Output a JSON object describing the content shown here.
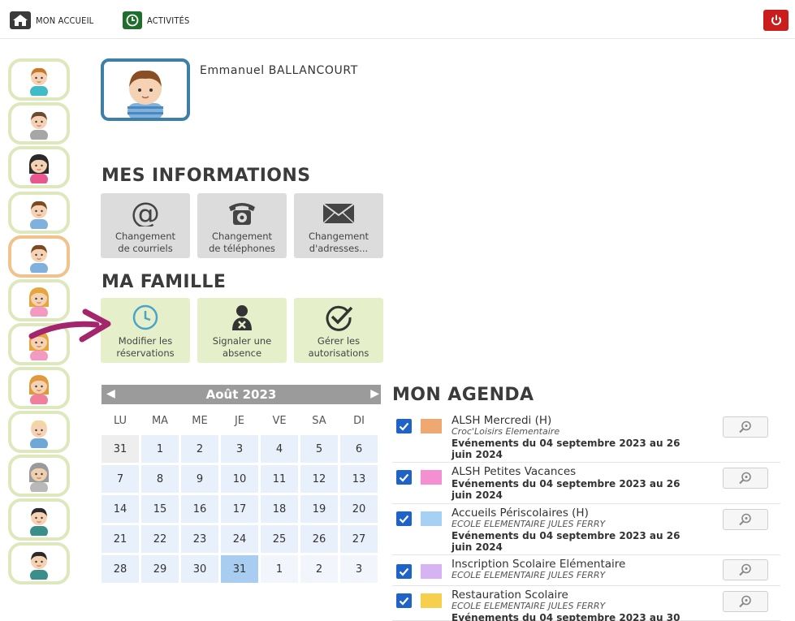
{
  "topbar": {
    "home_label": "MON ACCUEIL",
    "activities_label": "ACTIVITÉS"
  },
  "profile": {
    "name": "Emmanuel BALLANCOURT"
  },
  "mes_informations": {
    "title": "MES INFORMATIONS",
    "tiles": [
      {
        "line1": "Changement",
        "line2": "de courriels",
        "icon": "at-icon"
      },
      {
        "line1": "Changement",
        "line2": "de téléphones",
        "icon": "phone-icon"
      },
      {
        "line1": "Changement",
        "line2": "d'adresses...",
        "icon": "envelope-icon"
      }
    ]
  },
  "ma_famille": {
    "title": "MA FAMILLE",
    "tiles": [
      {
        "line1": "Modifier les",
        "line2": "réservations",
        "icon": "clock-icon"
      },
      {
        "line1": "Signaler une",
        "line2": "absence",
        "icon": "absence-icon"
      },
      {
        "line1": "Gérer les",
        "line2": "autorisations",
        "icon": "check-circle-icon"
      }
    ]
  },
  "calendar": {
    "month": "Août 2023",
    "prev": "◀",
    "next": "▶",
    "weekdays": [
      "LU",
      "MA",
      "ME",
      "JE",
      "VE",
      "SA",
      "DI"
    ],
    "weeks": [
      [
        "31",
        "1",
        "2",
        "3",
        "4",
        "5",
        "6"
      ],
      [
        "7",
        "8",
        "9",
        "10",
        "11",
        "12",
        "13"
      ],
      [
        "14",
        "15",
        "16",
        "17",
        "18",
        "19",
        "20"
      ],
      [
        "21",
        "22",
        "23",
        "24",
        "25",
        "26",
        "27"
      ],
      [
        "28",
        "29",
        "30",
        "31",
        "1",
        "2",
        "3"
      ]
    ]
  },
  "agenda": {
    "title": "MON AGENDA",
    "items": [
      {
        "title": "ALSH Mercredi (H)",
        "subtitle": "Croc'Loisirs Elementaire",
        "dates1": "Evénements du 04 septembre 2023 au 26",
        "dates2": "juin 2024",
        "color": "#f0a872"
      },
      {
        "title": "ALSH Petites Vacances",
        "subtitle": "",
        "dates1": "Evénements du 04 septembre 2023 au 26",
        "dates2": "juin 2024",
        "color": "#f48fd2"
      },
      {
        "title": "Accueils Périscolaires (H)",
        "subtitle": "ECOLE ELEMENTAIRE JULES FERRY",
        "dates1": "Evénements du 04 septembre 2023 au 26",
        "dates2": "juin 2024",
        "color": "#a6d1f5"
      },
      {
        "title": "Inscription Scolaire Elémentaire",
        "subtitle": "ECOLE ELEMENTAIRE JULES FERRY",
        "dates1": "",
        "dates2": "",
        "color": "#d6b3f2"
      },
      {
        "title": "Restauration Scolaire",
        "subtitle": "ECOLE ELEMENTAIRE JULES FERRY",
        "dates1": "Evénements du 04 septembre 2023 au 30",
        "dates2": "",
        "color": "#f6cf4c"
      }
    ]
  },
  "sidebar": {
    "avatars": [
      "girl-teal-shirt-avatar",
      "adult-man-grey-avatar",
      "woman-pink-avatar",
      "boy-striped-avatar",
      "boy-striped-avatar-selected",
      "girl-pigtails-avatar",
      "girl-pink-avatar",
      "girl-orange-avatar",
      "baby-avatar",
      "grandma-avatar",
      "man-teal-jacket-avatar",
      "man-teal-jacket-avatar"
    ]
  },
  "colors": {
    "header_border": "#e6e6e6",
    "profile_frame": "#3e7fa7",
    "avatar_border": "#dde8bd",
    "avatar_selected_border": "#f2c28c",
    "power_button": "#cc1d1d",
    "arrow": "#a4256c",
    "calendar_header": "#9b9b9b",
    "checkbox": "#1f63c8"
  }
}
